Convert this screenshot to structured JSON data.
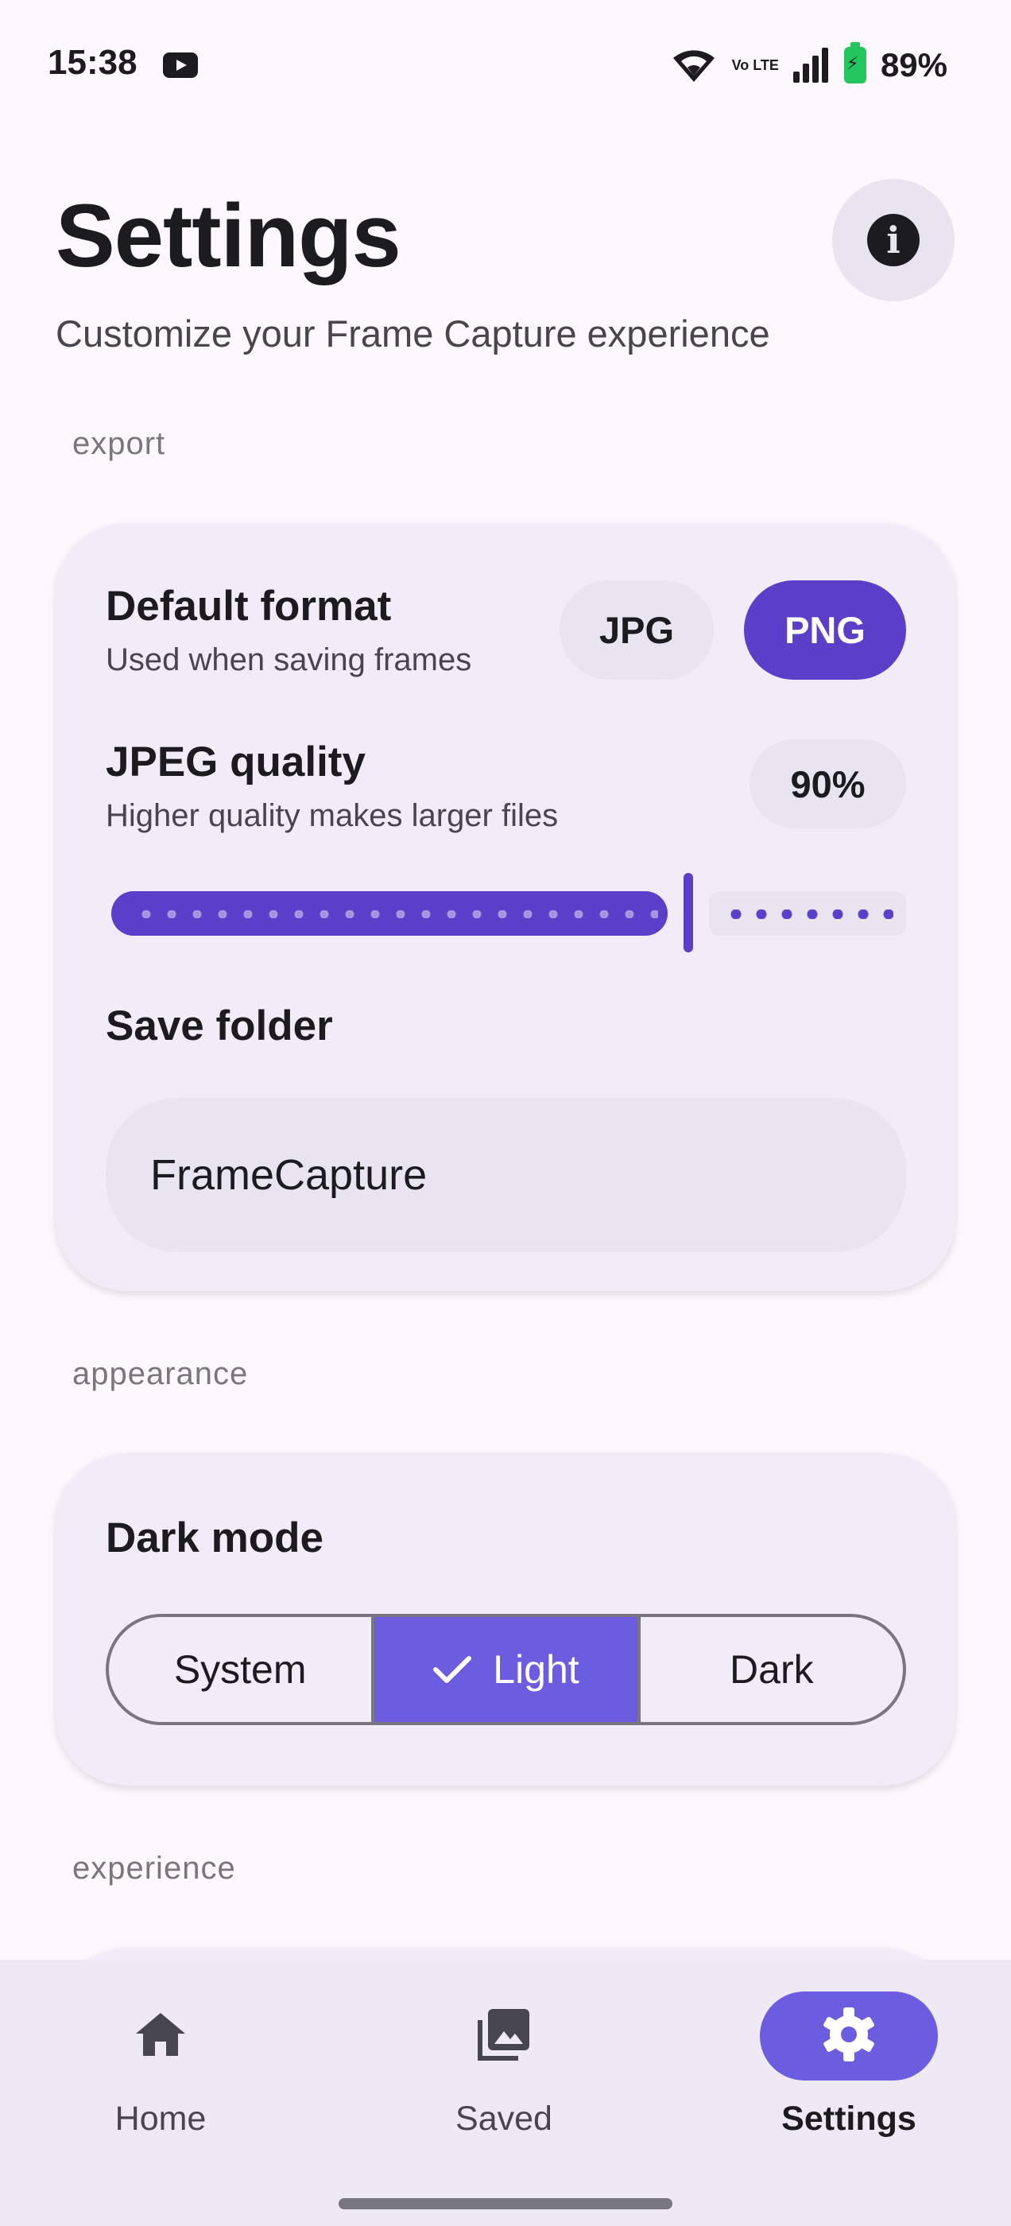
{
  "status_bar": {
    "time": "15:38",
    "network": "Vo LTE",
    "battery": "89%",
    "icons": [
      "youtube-icon",
      "wifi-icon",
      "volte-icon",
      "signal-icon",
      "battery-charging-icon"
    ]
  },
  "header": {
    "title": "Settings",
    "subtitle": "Customize your Frame Capture experience",
    "info_icon": "info-icon"
  },
  "export": {
    "section_label": "export",
    "default_format": {
      "title": "Default format",
      "subtitle": "Used when saving frames",
      "options": [
        "JPG",
        "PNG"
      ],
      "selected": "PNG"
    },
    "jpeg_quality": {
      "title": "JPEG quality",
      "subtitle": "Higher quality makes larger files",
      "value_label": "90%",
      "value": 0.9
    },
    "save_folder": {
      "title": "Save folder",
      "value": "FrameCapture"
    }
  },
  "appearance": {
    "section_label": "appearance",
    "dark_mode": {
      "title": "Dark mode",
      "options": [
        "System",
        "Light",
        "Dark"
      ],
      "selected": "Light"
    }
  },
  "experience": {
    "section_label": "experience"
  },
  "bottom_nav": {
    "items": [
      {
        "label": "Home",
        "icon": "home-icon"
      },
      {
        "label": "Saved",
        "icon": "gallery-icon"
      },
      {
        "label": "Settings",
        "icon": "gear-icon"
      }
    ],
    "active": "Settings"
  },
  "colors": {
    "background": "#fcf8fd",
    "card": "#f2ecf8",
    "accent": "#5b3fc9",
    "accent_light": "#6c5ce0",
    "chip": "#e8e5f0",
    "text": "#1c1b20",
    "muted": "#47464f"
  }
}
